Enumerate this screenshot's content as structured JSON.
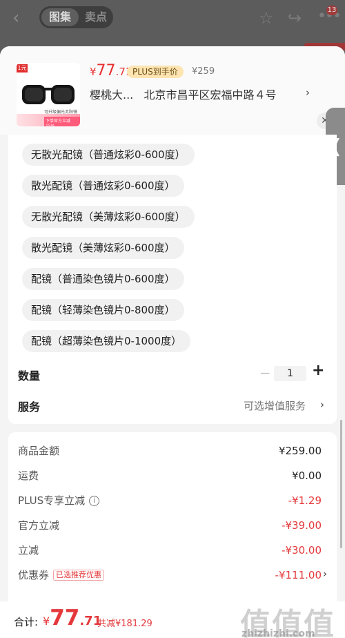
{
  "topbar": {
    "tab_gallery": "图集",
    "tab_selling": "卖点",
    "badge_count": "13",
    "icons": [
      "back-icon",
      "star-icon",
      "share-icon",
      "more-icon"
    ]
  },
  "header": {
    "thumb_tag": "1元",
    "thumb_note": "可升级偏光太阳镜",
    "thumb_band": "下单官方立减15%",
    "price_symbol": "¥",
    "price_int": "77",
    "price_dec": ".71",
    "plus_label": "PLUS到手价",
    "orig_price": "¥259",
    "shop": "樱桃大...",
    "address": "北京市昌平区宏福中路４号",
    "close_symbol": "✕"
  },
  "options": [
    "无散光配镜（普通炫彩0-600度）",
    "散光配镜（普通炫彩0-600度）",
    "无散光配镜（美薄炫彩0-600度）",
    "散光配镜（美薄炫彩0-600度）",
    "配镜（普通染色镜片0-600度）",
    "配镜（轻薄染色镜片0-800度）",
    "配镜（超薄染色镜片0-1000度）"
  ],
  "quantity": {
    "label": "数量",
    "value": "1",
    "minus": "−",
    "plus": "+"
  },
  "service": {
    "label": "服务",
    "value": "可选增值服务"
  },
  "price_rows": [
    {
      "label": "商品金额",
      "value": "¥259.00"
    },
    {
      "label": "运费",
      "value": "¥0.00"
    },
    {
      "label": "PLUS专享立减",
      "value": "-¥1.29"
    },
    {
      "label": "官方立减",
      "value": "-¥39.00"
    },
    {
      "label": "立减",
      "value": "-¥30.00"
    },
    {
      "label": "优惠券",
      "value": "-¥111.00"
    }
  ],
  "coupon_tag": "已选推荐优惠",
  "footer": {
    "total_label": "合计:",
    "currency": "¥",
    "total_int": "77",
    "total_dec": ".71",
    "saved": "共减¥181.29"
  },
  "watermark": {
    "logo": "值值值",
    "url": "zhizhizhi.com"
  },
  "colors": {
    "accent_red": "#e4393c",
    "plus_gold": "#fde4b1"
  }
}
